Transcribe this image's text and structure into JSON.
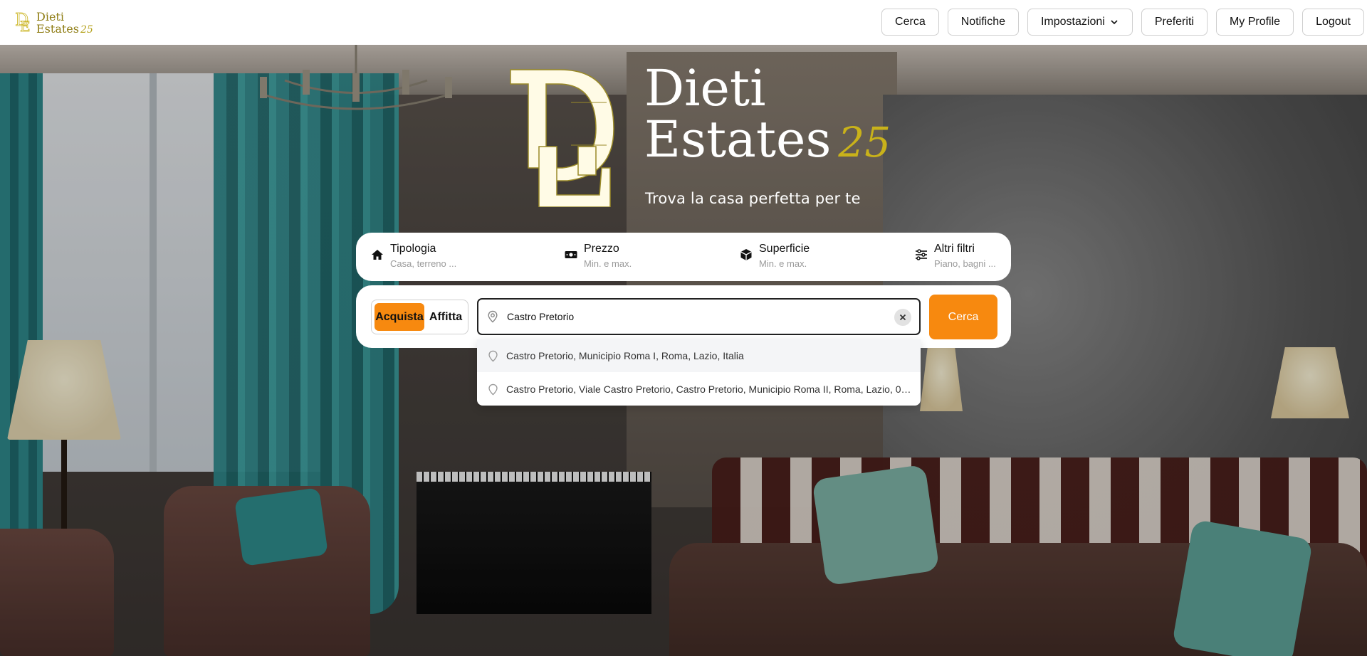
{
  "app": {
    "brand_line1": "Dieti",
    "brand_line2": "Estates",
    "brand_number": "25",
    "monogram": "DE"
  },
  "nav": {
    "items": [
      {
        "label": "Cerca"
      },
      {
        "label": "Notifiche"
      },
      {
        "label": "Impostazioni",
        "has_dropdown": true,
        "icon": "chevron-down-icon"
      },
      {
        "label": "Preferiti"
      },
      {
        "label": "My Profile"
      },
      {
        "label": "Logout"
      }
    ]
  },
  "hero": {
    "title_line1": "Dieti",
    "title_line2": "Estates",
    "title_number": "25",
    "tagline": "Trova la casa perfetta per te"
  },
  "filters": [
    {
      "label": "Tipologia",
      "hint": "Casa, terreno ...",
      "icon": "home-icon"
    },
    {
      "label": "Prezzo",
      "hint": "Min. e max.",
      "icon": "banknote-icon"
    },
    {
      "label": "Superficie",
      "hint": "Min. e max.",
      "icon": "cube-icon"
    },
    {
      "label": "Altri filtri",
      "hint": "Piano, bagni ...",
      "icon": "sliders-icon"
    }
  ],
  "search": {
    "mode_options": [
      "Acquista",
      "Affitta"
    ],
    "selected_mode": "Acquista",
    "value": "Castro Pretorio",
    "button_label": "Cerca",
    "suggestions": [
      "Castro Pretorio, Municipio Roma I, Roma, Lazio, Italia",
      "Castro Pretorio, Viale Castro Pretorio, Castro Pretorio, Municipio Roma II, Roma, Lazio, 001..."
    ]
  },
  "colors": {
    "accent": "#f7890f",
    "brand_gold": "#8f7d14",
    "brand_gold_light": "#c9b21a",
    "white": "#ffffff"
  }
}
